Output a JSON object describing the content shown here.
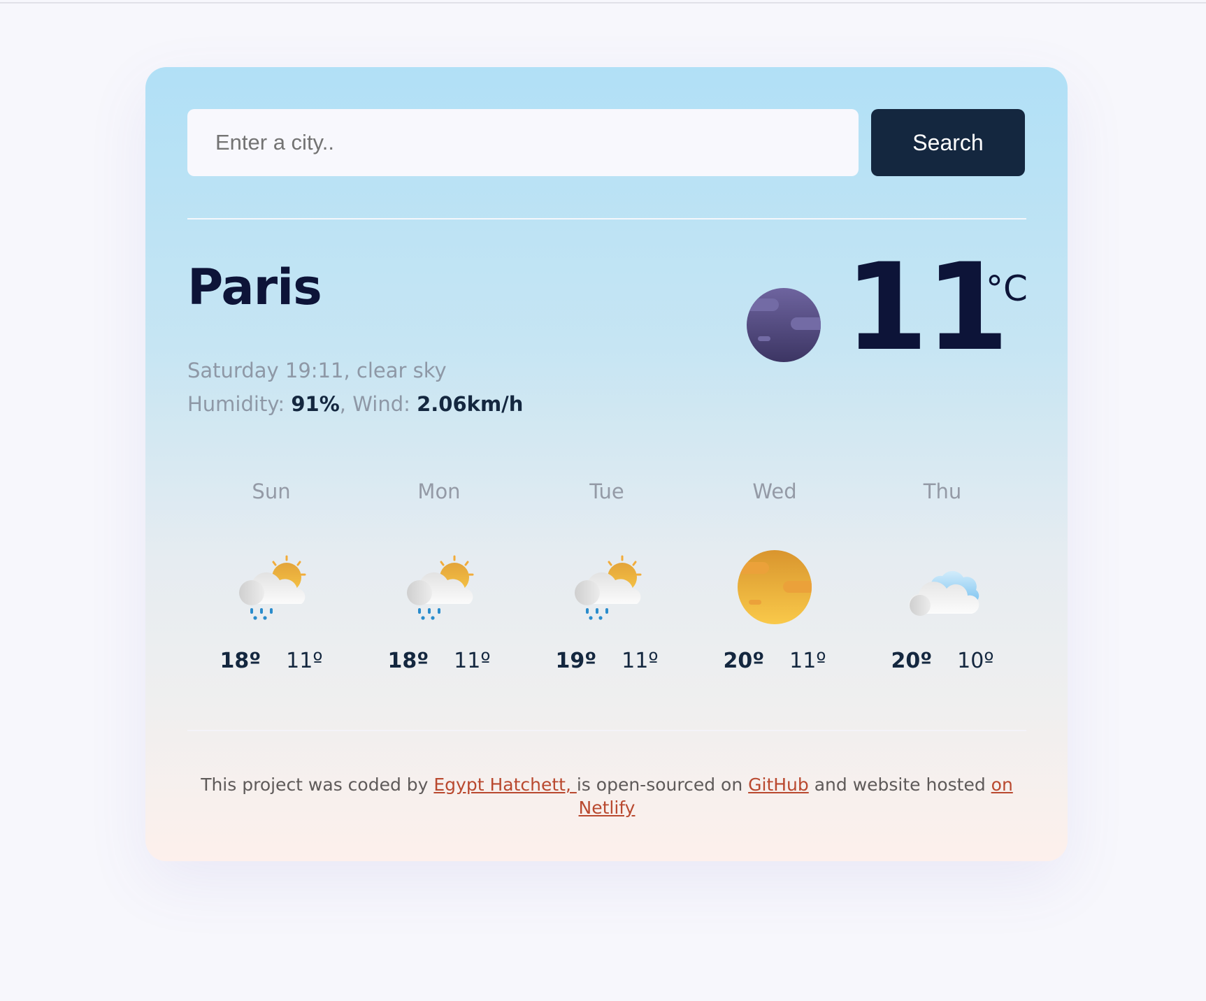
{
  "search": {
    "placeholder": "Enter a city..",
    "value": "",
    "button_label": "Search"
  },
  "current": {
    "city": "Paris",
    "day_time": "Saturday 19:11",
    "description": "clear sky",
    "humidity_label": "Humidity:",
    "humidity_value": "91%",
    "wind_label": "Wind:",
    "wind_value": "2.06km/h",
    "temperature": "11",
    "unit": "°C",
    "icon": "clear-night-icon"
  },
  "forecast": [
    {
      "day": "Sun",
      "icon": "rain-partly-sunny-icon",
      "max": "18º",
      "min": "11º"
    },
    {
      "day": "Mon",
      "icon": "rain-partly-sunny-icon",
      "max": "18º",
      "min": "11º"
    },
    {
      "day": "Tue",
      "icon": "rain-partly-sunny-icon",
      "max": "19º",
      "min": "11º"
    },
    {
      "day": "Wed",
      "icon": "clear-day-icon",
      "max": "20º",
      "min": "11º"
    },
    {
      "day": "Thu",
      "icon": "cloudy-icon",
      "max": "20º",
      "min": "10º"
    }
  ],
  "footer": {
    "text_1": "This project was coded by ",
    "author_link": "Egypt Hatchett, ",
    "text_2": "is open-sourced on ",
    "github_link": "GitHub",
    "text_3": " and website hosted ",
    "netlify_link": "on Netlify"
  },
  "colors": {
    "button_bg": "#14273f",
    "heading": "#0d1438",
    "link": "#b9492f",
    "muted": "#8e98a6"
  }
}
